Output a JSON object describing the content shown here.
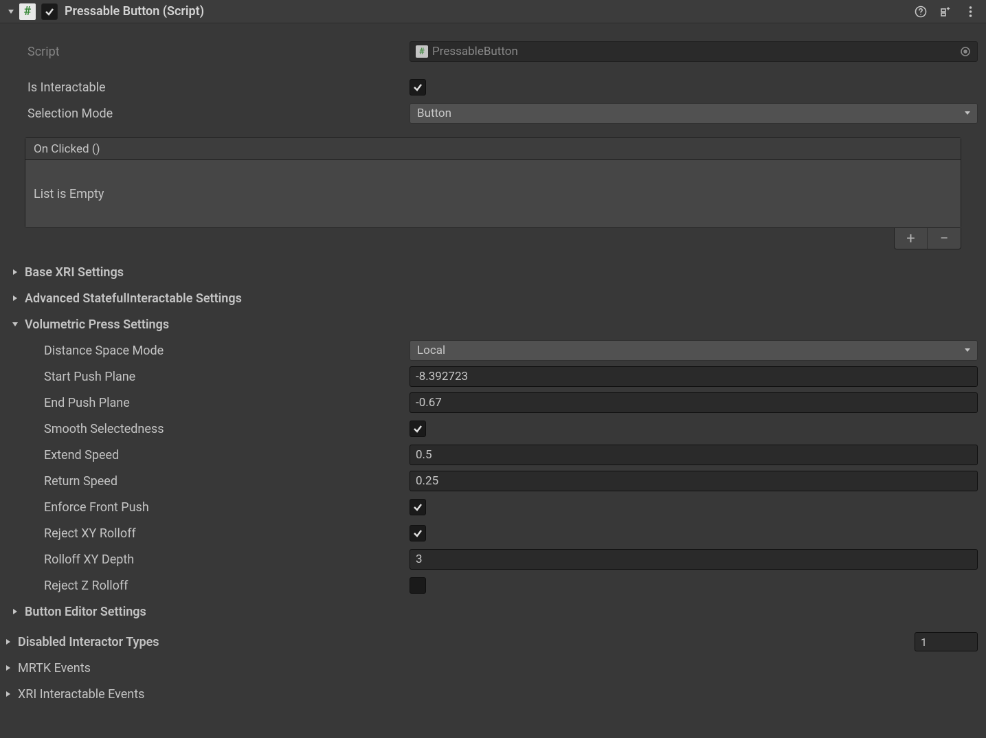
{
  "header": {
    "title": "Pressable Button (Script)",
    "enabled": true
  },
  "script": {
    "label": "Script",
    "value": "PressableButton"
  },
  "isInteractable": {
    "label": "Is Interactable",
    "checked": true
  },
  "selectionMode": {
    "label": "Selection Mode",
    "value": "Button"
  },
  "onClicked": {
    "header": "On Clicked ()",
    "empty": "List is Empty"
  },
  "foldouts": {
    "baseXRI": "Base XRI Settings",
    "advancedStateful": "Advanced StatefulInteractable Settings",
    "volumetricPress": "Volumetric Press Settings",
    "buttonEditor": "Button Editor Settings",
    "disabledInteractor": "Disabled Interactor Types",
    "mrtkEvents": "MRTK Events",
    "xriEvents": "XRI Interactable Events"
  },
  "volumetric": {
    "distanceSpaceMode": {
      "label": "Distance Space Mode",
      "value": "Local"
    },
    "startPushPlane": {
      "label": "Start Push Plane",
      "value": "-8.392723"
    },
    "endPushPlane": {
      "label": "End Push Plane",
      "value": "-0.67"
    },
    "smoothSelectedness": {
      "label": "Smooth Selectedness",
      "checked": true
    },
    "extendSpeed": {
      "label": "Extend Speed",
      "value": "0.5"
    },
    "returnSpeed": {
      "label": "Return Speed",
      "value": "0.25"
    },
    "enforceFrontPush": {
      "label": "Enforce Front Push",
      "checked": true
    },
    "rejectXYRolloff": {
      "label": "Reject XY Rolloff",
      "checked": true
    },
    "rolloffXYDepth": {
      "label": "Rolloff XY Depth",
      "value": "3"
    },
    "rejectZRolloff": {
      "label": "Reject Z Rolloff",
      "checked": false
    }
  },
  "disabledInteractorCount": "1"
}
